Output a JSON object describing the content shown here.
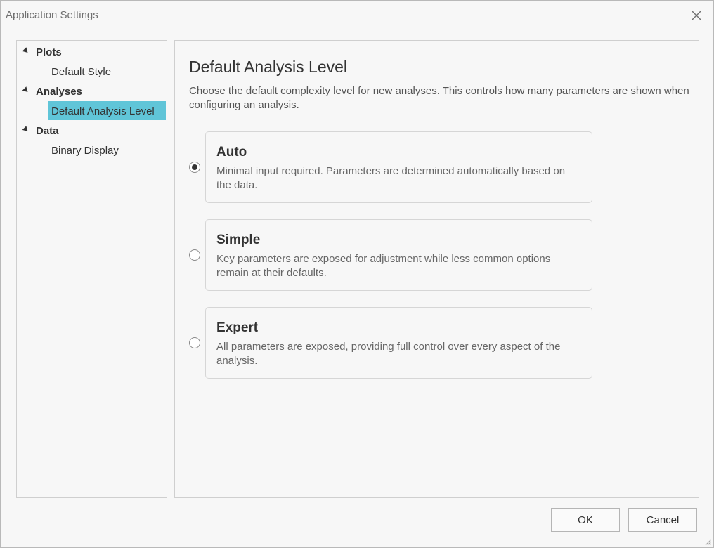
{
  "window": {
    "title": "Application Settings"
  },
  "tree": {
    "groups": [
      {
        "label": "Plots",
        "children": [
          {
            "label": "Default Style"
          }
        ]
      },
      {
        "label": "Analyses",
        "children": [
          {
            "label": "Default Analysis Level",
            "selected": true
          }
        ]
      },
      {
        "label": "Data",
        "children": [
          {
            "label": "Binary Display"
          }
        ]
      }
    ]
  },
  "content": {
    "heading": "Default Analysis Level",
    "description": "Choose the default complexity level for new analyses. This controls how many parameters are shown when configuring an analysis.",
    "options": [
      {
        "title": "Auto",
        "description": "Minimal input required. Parameters are determined automatically based on the data.",
        "selected": true
      },
      {
        "title": "Simple",
        "description": "Key parameters are exposed for adjustment while less common options remain at their defaults.",
        "selected": false
      },
      {
        "title": "Expert",
        "description": "All parameters are exposed, providing full control over every aspect of the analysis.",
        "selected": false
      }
    ]
  },
  "buttons": {
    "ok": "OK",
    "cancel": "Cancel"
  },
  "colors": {
    "selection": "#60c5d8",
    "background": "#f7f7f7"
  }
}
